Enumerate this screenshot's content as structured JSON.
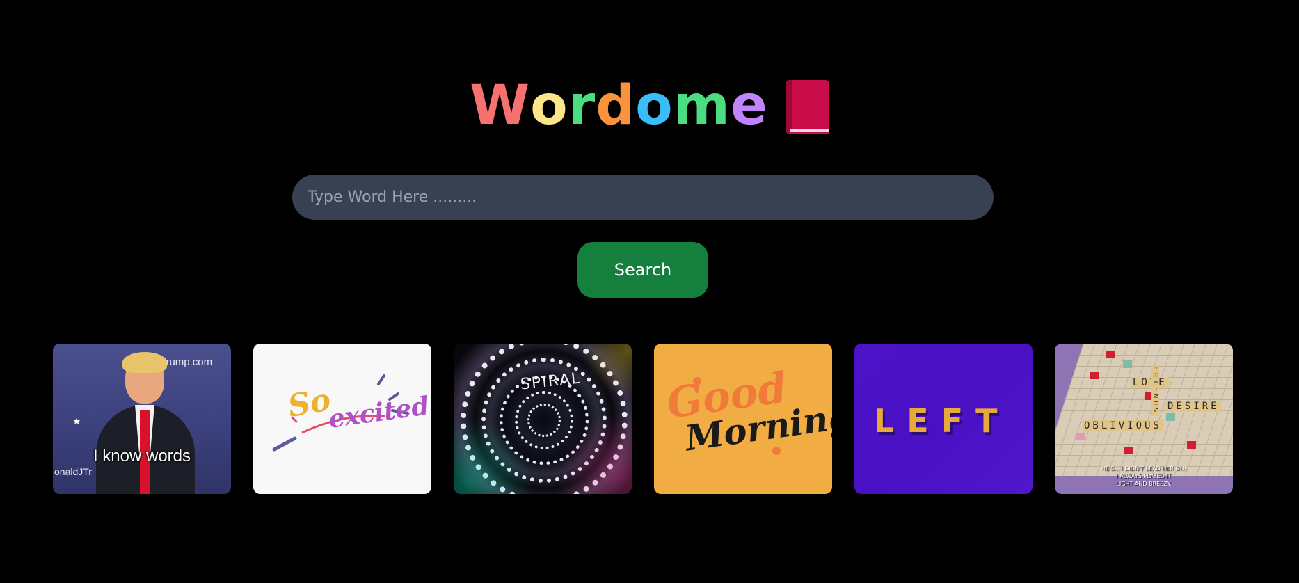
{
  "app": {
    "title_letters": [
      "W",
      "o",
      "r",
      "d",
      "o",
      "m",
      "e"
    ],
    "title_colors": [
      "#f87171",
      "#fde68a",
      "#4ade80",
      "#fb923c",
      "#38bdf8",
      "#4ade80",
      "#c084fc"
    ],
    "title_icon": "closed-book-icon"
  },
  "search": {
    "placeholder": "Type Word Here .........",
    "value": "",
    "button_label": "Search"
  },
  "gallery": {
    "items": [
      {
        "caption": "I know words",
        "watermark_top": "naldJTrump.com",
        "watermark_bottom": "onaldJTr"
      },
      {
        "text_a": "So",
        "text_b": "excited"
      },
      {
        "text": "SPIRAL"
      },
      {
        "text_a": "Good",
        "text_b": "Morning"
      },
      {
        "text": "LEFT"
      },
      {
        "words": [
          "LOVE",
          "FRIENDS",
          "DESIRE",
          "OBLIVIOUS"
        ],
        "caption_lines": [
          "HE'S... I DIDN'T LEAD HER ON!",
          "I ALWAYS PLAYED IT",
          "LIGHT AND BREEZY."
        ]
      }
    ]
  }
}
